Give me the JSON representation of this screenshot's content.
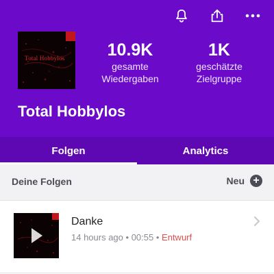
{
  "header": {
    "plays": {
      "value": "10.9K",
      "label_line1": "gesamte",
      "label_line2": "Wiedergaben"
    },
    "audience": {
      "value": "1K",
      "label_line1": "geschätzte",
      "label_line2": "Zielgruppe"
    },
    "show_title": "Total Hobbylos",
    "cover_text": "Total Hobbylos",
    "icons": [
      "bell-icon",
      "share-icon",
      "more-icon"
    ],
    "color": "#6b0ac9"
  },
  "tabs": [
    {
      "label": "Folgen",
      "active": true
    },
    {
      "label": "Analytics",
      "active": false
    }
  ],
  "episodes_section": {
    "title": "Deine Folgen",
    "new_label": "Neu"
  },
  "episodes": [
    {
      "title": "Danke",
      "time": "14 hours ago",
      "duration": "00:55",
      "status": "Entwurf"
    }
  ]
}
